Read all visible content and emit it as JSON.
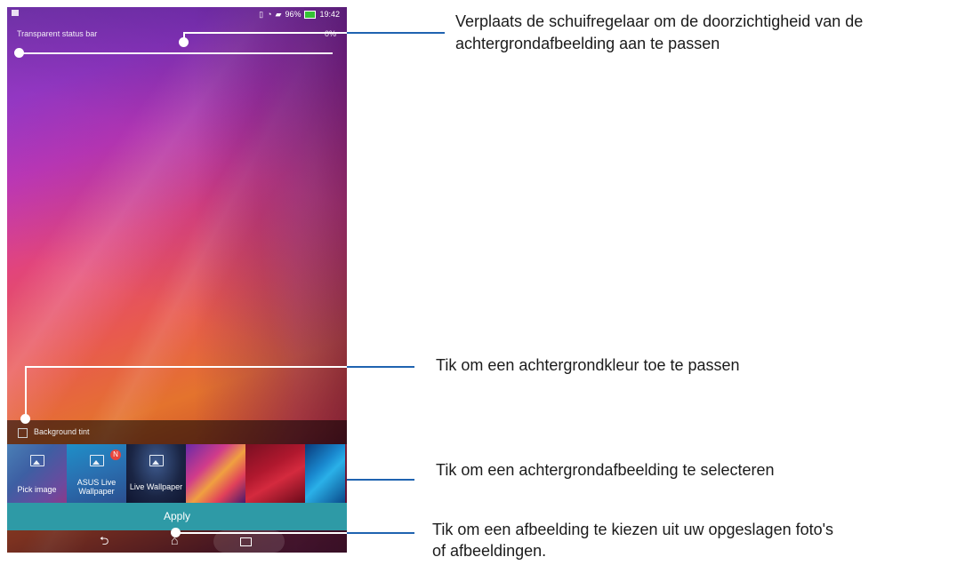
{
  "statusbar": {
    "battery": "96%",
    "time": "19:42"
  },
  "settings": {
    "transparent_label": "Transparent status bar",
    "transparent_value": "0%",
    "slider_level_percent": 0,
    "background_tint_label": "Background tint"
  },
  "thumbnails": {
    "pick_image": "Pick image",
    "asus_live_line1": "ASUS Live",
    "asus_live_line2": "Wallpaper",
    "asus_badge": "N",
    "live_wallpaper": "Live Wallpaper"
  },
  "apply_label": "Apply",
  "nav": {
    "back_glyph": "⮌",
    "home_glyph": "⌂"
  },
  "callouts": {
    "slider_line1": "Verplaats de schuifregelaar om de doorzichtigheid van de",
    "slider_line2": "achtergrondafbeelding aan te passen",
    "tint": "Tik om een achtergrondkleur toe te passen",
    "wallpaper": "Tik om een achtergrondafbeelding te selecteren",
    "pick_line1": "Tik om een afbeelding te kiezen uit uw opgeslagen foto's",
    "pick_line2": "of afbeeldingen."
  },
  "colors": {
    "apply_bar": "#2e9aa6",
    "callout_accent": "#1f63b0"
  }
}
